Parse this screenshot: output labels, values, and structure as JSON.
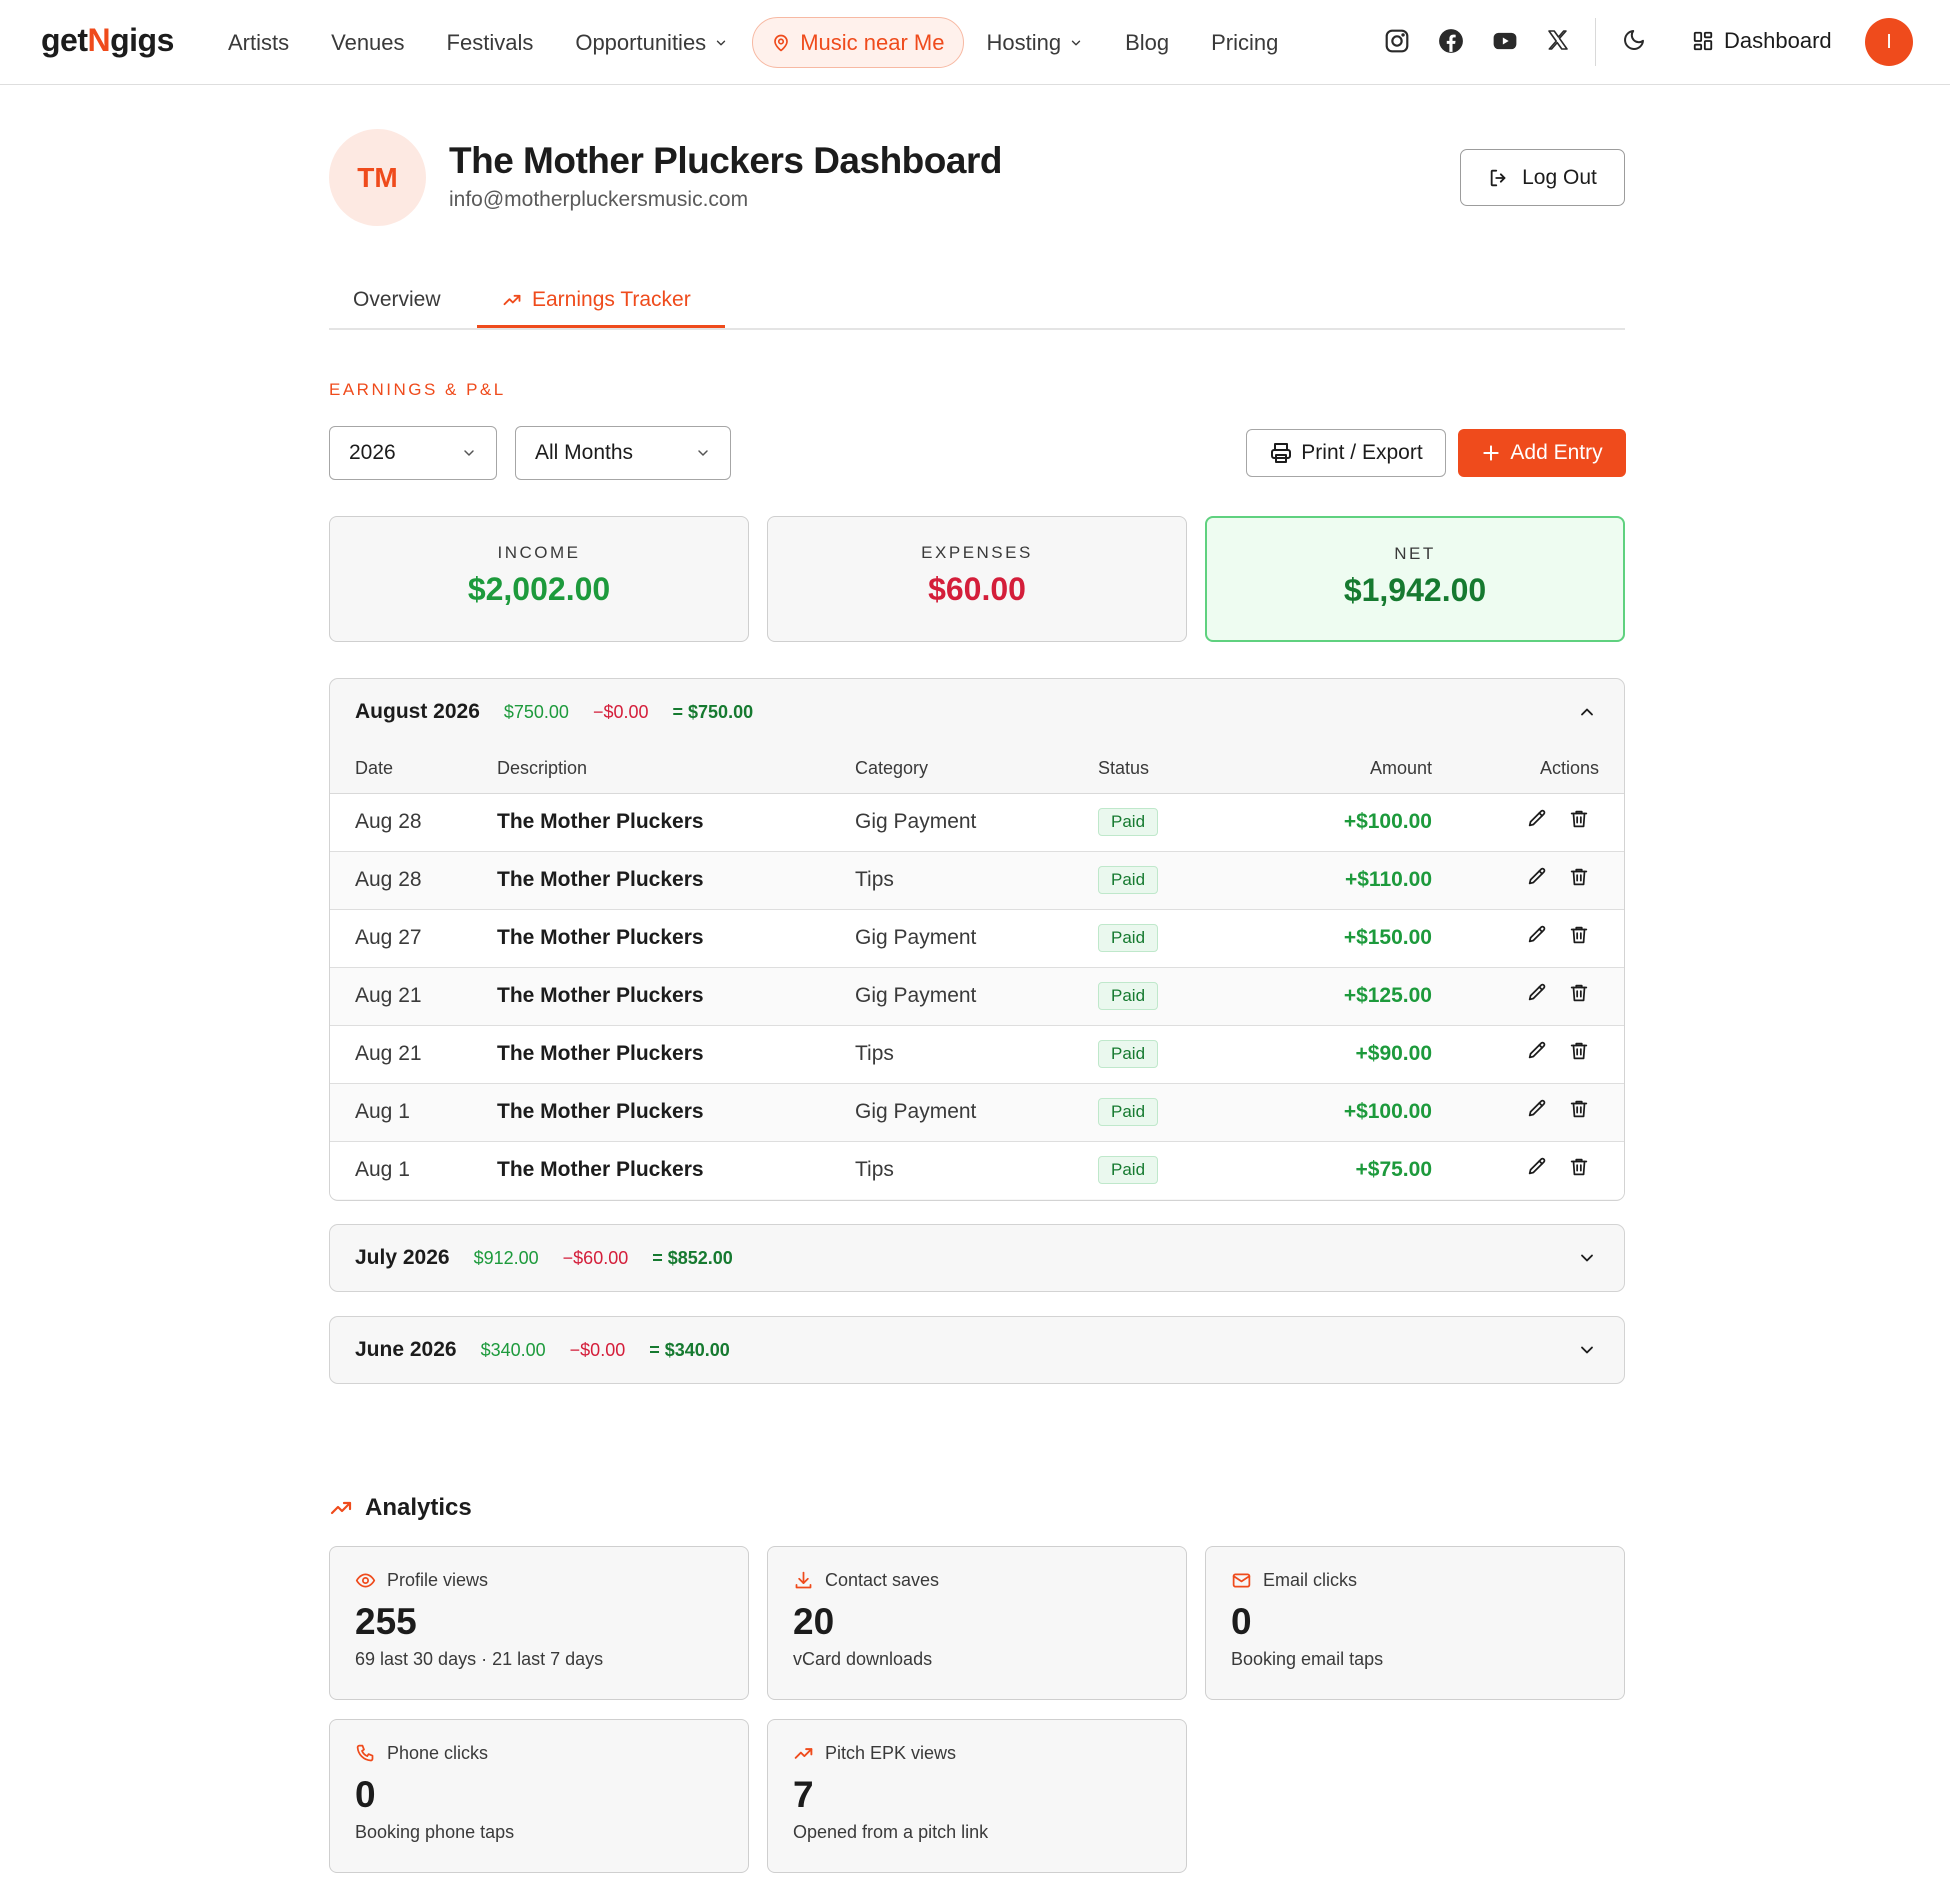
{
  "nav": {
    "logo_pre": "get",
    "logo_n": "N",
    "logo_post": "gigs",
    "links": [
      "Artists",
      "Venues",
      "Festivals",
      "Opportunities"
    ],
    "music_near_me": "Music near Me",
    "links2": [
      "Hosting",
      "Blog",
      "Pricing"
    ],
    "social_icons": [
      "instagram-icon",
      "facebook-icon",
      "youtube-icon",
      "x-icon"
    ],
    "dashboard": "Dashboard",
    "avatar_initial": "I"
  },
  "profile": {
    "initials": "TM",
    "title": "The Mother Pluckers Dashboard",
    "email": "info@motherpluckersmusic.com",
    "logout": "Log Out"
  },
  "tabs": {
    "overview": "Overview",
    "earnings": "Earnings Tracker"
  },
  "earnings": {
    "section_label": "EARNINGS & P&L",
    "year": "2026",
    "months_filter": "All Months",
    "print_export": "Print / Export",
    "add_entry": "Add Entry"
  },
  "summary": {
    "income_label": "INCOME",
    "income_value": "$2,002.00",
    "expenses_label": "EXPENSES",
    "expenses_value": "$60.00",
    "net_label": "NET",
    "net_value": "$1,942.00"
  },
  "months": [
    {
      "name": "August 2026",
      "income": "$750.00",
      "expenses": "−$0.00",
      "net": "= $750.00",
      "expanded": true
    },
    {
      "name": "July 2026",
      "income": "$912.00",
      "expenses": "−$60.00",
      "net": "= $852.00",
      "expanded": false
    },
    {
      "name": "June 2026",
      "income": "$340.00",
      "expenses": "−$0.00",
      "net": "= $340.00",
      "expanded": false
    }
  ],
  "table": {
    "headers": {
      "date": "Date",
      "description": "Description",
      "category": "Category",
      "status": "Status",
      "amount": "Amount",
      "actions": "Actions"
    },
    "rows": [
      {
        "date": "Aug 28",
        "description": "The Mother Pluckers",
        "category": "Gig Payment",
        "status": "Paid",
        "amount": "+$100.00"
      },
      {
        "date": "Aug 28",
        "description": "The Mother Pluckers",
        "category": "Tips",
        "status": "Paid",
        "amount": "+$110.00"
      },
      {
        "date": "Aug 27",
        "description": "The Mother Pluckers",
        "category": "Gig Payment",
        "status": "Paid",
        "amount": "+$150.00"
      },
      {
        "date": "Aug 21",
        "description": "The Mother Pluckers",
        "category": "Gig Payment",
        "status": "Paid",
        "amount": "+$125.00"
      },
      {
        "date": "Aug 21",
        "description": "The Mother Pluckers",
        "category": "Tips",
        "status": "Paid",
        "amount": "+$90.00"
      },
      {
        "date": "Aug 1",
        "description": "The Mother Pluckers",
        "category": "Gig Payment",
        "status": "Paid",
        "amount": "+$100.00"
      },
      {
        "date": "Aug 1",
        "description": "The Mother Pluckers",
        "category": "Tips",
        "status": "Paid",
        "amount": "+$75.00"
      }
    ]
  },
  "analytics": {
    "title": "Analytics",
    "cards": [
      {
        "label": "Profile views",
        "value": "255",
        "sub": "69 last 30 days · 21 last 7 days",
        "icon": "eye-icon"
      },
      {
        "label": "Contact saves",
        "value": "20",
        "sub": "vCard downloads",
        "icon": "download-icon"
      },
      {
        "label": "Email clicks",
        "value": "0",
        "sub": "Booking email taps",
        "icon": "mail-icon"
      },
      {
        "label": "Phone clicks",
        "value": "0",
        "sub": "Booking phone taps",
        "icon": "phone-icon"
      },
      {
        "label": "Pitch EPK views",
        "value": "7",
        "sub": "Opened from a pitch link",
        "icon": "trending-up-icon"
      }
    ]
  },
  "colors": {
    "accent": "#ef4b1c",
    "income_green": "#1d9a3c",
    "net_green": "#167a30",
    "expense_red": "#d41e3a"
  }
}
